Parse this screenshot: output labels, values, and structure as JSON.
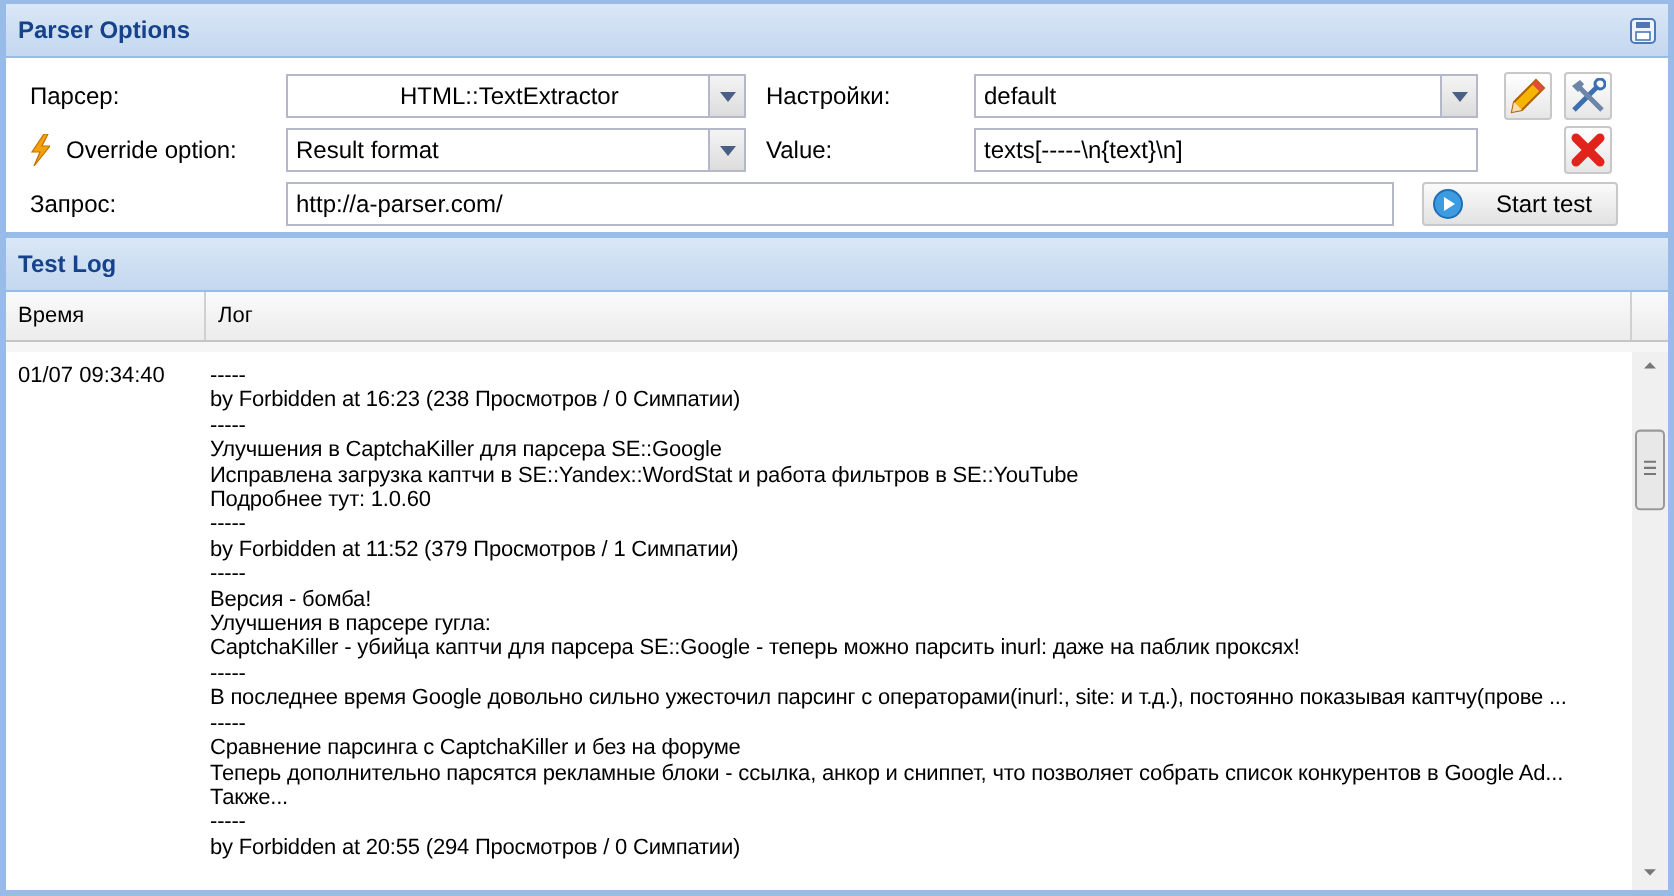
{
  "panel": {
    "title": "Parser Options"
  },
  "form": {
    "parser": {
      "label": "Парсер:",
      "value": "HTML::TextExtractor"
    },
    "settings": {
      "label": "Настройки:",
      "value": "default"
    },
    "override": {
      "label": "Override option:",
      "value": "Result format"
    },
    "value": {
      "label": "Value:",
      "value": "texts[-----\\n{text}\\n]"
    },
    "query": {
      "label": "Запрос:",
      "value": "http://a-parser.com/"
    },
    "start_button": "Start test"
  },
  "log": {
    "title": "Test Log",
    "columns": [
      "Время",
      "Лог"
    ],
    "rows": [
      {
        "time": "01/07 09:34:40",
        "lines": [
          "-----",
          "by Forbidden at 16:23 (238 Просмотров / 0 Симпатии)",
          "-----",
          "Улучшения в CaptchaKiller для парсера SE::Google",
          "Исправлена загрузка каптчи в SE::Yandex::WordStat и работа фильтров в SE::YouTube",
          "Подробнее тут: 1.0.60",
          "-----",
          "by Forbidden at 11:52 (379 Просмотров / 1 Симпатии)",
          "-----",
          "Версия - бомба!",
          "Улучшения в парсере гугла:",
          "CaptchaKiller - убийца каптчи для парсера SE::Google - теперь можно парсить inurl: даже на паблик проксях!",
          "-----",
          "В последнее время Google довольно сильно ужесточил парсинг с операторами(inurl:, site: и т.д.), постоянно показывая каптчу(прове  ...",
          "-----",
          "Сравнение парсинга с CaptchaKiller и без на форуме",
          "Теперь дополнительно парсятся рекламные блоки - ссылка, анкор и сниппет, что позволяет собрать список конкурентов в Google Ad...",
          "Также...",
          "-----",
          "by Forbidden at 20:55 (294 Просмотров / 0 Симпатии)"
        ]
      }
    ]
  }
}
